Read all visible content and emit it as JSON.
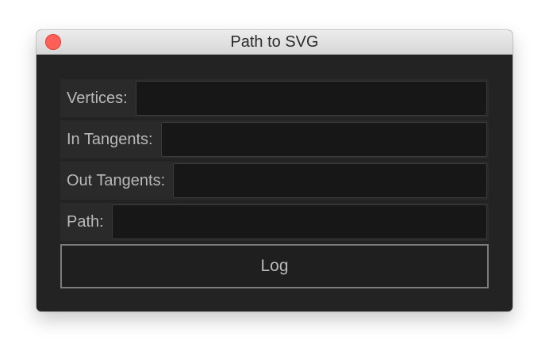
{
  "window": {
    "title": "Path to SVG"
  },
  "fields": [
    {
      "label": "Vertices:",
      "value": ""
    },
    {
      "label": "In Tangents:",
      "value": ""
    },
    {
      "label": "Out Tangents:",
      "value": ""
    },
    {
      "label": "Path:",
      "value": ""
    }
  ],
  "actions": {
    "log_label": "Log"
  },
  "colors": {
    "window_bg": "#232323",
    "close_button": "#fe5f57",
    "field_bg": "#171717",
    "button_border": "#7c7c7c"
  }
}
